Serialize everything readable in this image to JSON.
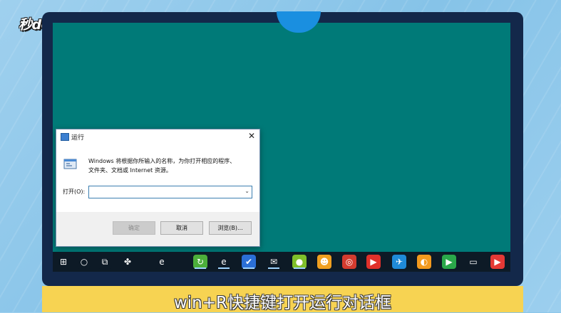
{
  "watermark": {
    "logo_text": "秒dong视频"
  },
  "colors": {
    "desktop": "#007a78",
    "taskbar": "#0d1a26",
    "caption_bar": "#f7d352",
    "monitor_frame": "#13284a"
  },
  "run_dialog": {
    "title": "运行",
    "close_glyph": "✕",
    "description_line1": "Windows 将根据你所输入的名称，为你打开相应的程序、",
    "description_line2": "文件夹、文档或 Internet 资源。",
    "open_label": "打开(O):",
    "input_value": "",
    "dropdown_glyph": "⌄",
    "ok_label": "确定",
    "cancel_label": "取消",
    "browse_label": "浏览(B)..."
  },
  "taskbar": {
    "icons": [
      {
        "name": "start-icon",
        "glyph": "⊞",
        "color": "#0d1a26"
      },
      {
        "name": "search-circle-icon",
        "glyph": "○",
        "color": "#0d1a26"
      },
      {
        "name": "task-view-icon",
        "glyph": "⧉",
        "color": "#0d1a26"
      },
      {
        "name": "pinwheel-icon",
        "glyph": "✤",
        "color": "#0d1a26"
      },
      {
        "name": "ie-icon",
        "glyph": "e",
        "color": "#0d1a26"
      },
      {
        "name": "green-app-icon",
        "glyph": "↻",
        "color": "#4cae3a"
      },
      {
        "name": "edge-icon",
        "glyph": "e",
        "color": "#0d1a26"
      },
      {
        "name": "blue-shield-icon",
        "glyph": "✔",
        "color": "#2b6fd6"
      },
      {
        "name": "wechat-icon",
        "glyph": "✉",
        "color": "#0d1a26"
      },
      {
        "name": "yellow-app-icon",
        "glyph": "●",
        "color": "#7fbf2a"
      },
      {
        "name": "cat-app-icon",
        "glyph": "☻",
        "color": "#f0a020"
      },
      {
        "name": "netease-music-icon",
        "glyph": "◎",
        "color": "#d43b2f"
      },
      {
        "name": "red-player-icon",
        "glyph": "▶",
        "color": "#e0302a"
      },
      {
        "name": "feishu-icon",
        "glyph": "✈",
        "color": "#1f8ad8"
      },
      {
        "name": "orange-app-icon",
        "glyph": "◐",
        "color": "#f39a1e"
      },
      {
        "name": "green-play-icon",
        "glyph": "▶",
        "color": "#2aa84a"
      },
      {
        "name": "screen-icon",
        "glyph": "▭",
        "color": "#0d1a26"
      },
      {
        "name": "play-store-icon",
        "glyph": "▶",
        "color": "#e53935"
      }
    ]
  },
  "caption": {
    "text": "win+R快捷键打开运行对话框"
  }
}
